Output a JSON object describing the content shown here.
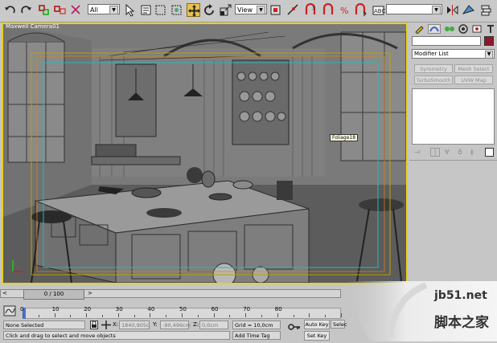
{
  "toolbar": {
    "selection_filter": "All",
    "reference_coord": "View",
    "named_selection_set": ""
  },
  "viewport": {
    "label": "Maxwell Camera01",
    "object_tag": "Foliage18"
  },
  "command_panel": {
    "modifier_list_label": "Modifier List",
    "buttons": {
      "symmetry": "Symmetry",
      "mesh_select": "Mesh Select",
      "turbosmooth": "TurboSmooth",
      "uvw_map": "UVW Map"
    },
    "object_color": "#8a1a2a"
  },
  "timeline": {
    "frame_counter": "0 / 100",
    "current_frame": 0,
    "total_frames": 100,
    "ruler_labels": [
      "0",
      "10",
      "20",
      "30",
      "40",
      "50",
      "60",
      "70",
      "80"
    ]
  },
  "status": {
    "selection_text": "None Selected",
    "prompt_text": "Click and drag to select and move objects",
    "x_label": "X:",
    "x_value": "1840,905c",
    "y_label": "Y:",
    "y_value": "-90,496cm",
    "z_label": "Z:",
    "z_value": "0,0cm",
    "grid": "Grid = 10,0cm",
    "add_time_tag": "Add Time Tag",
    "auto_key": "Auto Key",
    "set_key": "Set Key",
    "selected_dropdown": "Selec"
  },
  "watermark": {
    "site": "jb51.net",
    "chinese": "脚本之家"
  }
}
